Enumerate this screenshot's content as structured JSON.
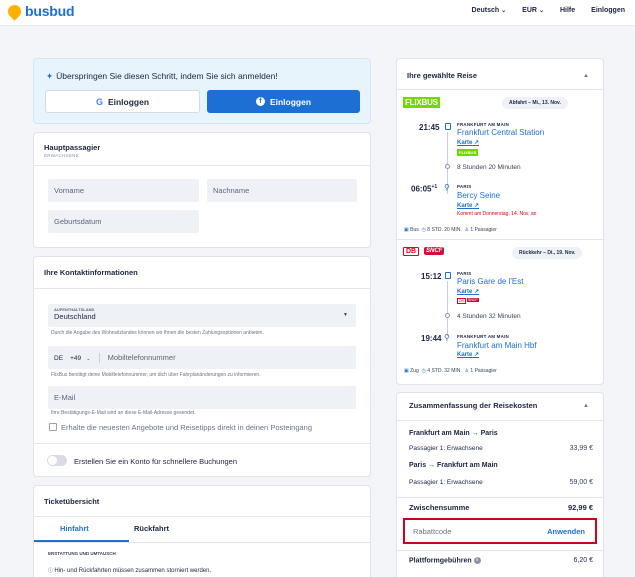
{
  "brand": {
    "name": "busbud"
  },
  "nav": {
    "language": "Deutsch",
    "currency": "EUR",
    "help": "Hilfe",
    "login": "Einloggen"
  },
  "login_card": {
    "title": "Überspringen Sie diesen Schritt, indem Sie sich anmelden!",
    "google_label": "Einloggen",
    "facebook_label": "Einloggen"
  },
  "passenger": {
    "title": "Hauptpassagier",
    "subtitle": "ERWACHSENE",
    "first_name_placeholder": "Vorname",
    "last_name_placeholder": "Nachname",
    "birthdate_placeholder": "Geburtsdatum"
  },
  "contact": {
    "title": "Ihre Kontaktinformationen",
    "country_label": "AUFENTHALTSLAND",
    "country_value": "Deutschland",
    "country_helper": "Durch die Angabe des Wohnsitzlandes können wir Ihnen die besten Zahlungsoptionen anbieten.",
    "phone_country": "DE",
    "phone_prefix": "+49",
    "phone_placeholder": "Mobiltelefonnummer",
    "phone_helper": "FlixBus benötigt deine Mobiltelefonnummer, um dich über Fahrplanänderungen zu informieren.",
    "email_placeholder": "E-Mail",
    "email_helper": "Ihre Bestätigungs-E-Mail wird an diese E-Mail-Adresse gesendet.",
    "offers_label": "Erhalte die neuesten Angebote und Reisetipps direkt in deinen Posteingang",
    "account_label": "Erstellen Sie ein Konto für schnellere Buchungen"
  },
  "ticket": {
    "title": "Ticketübersicht",
    "tabs": [
      "Hinfahrt",
      "Rückfahrt"
    ],
    "refund_label": "ERSTATTUNG UND UMTAUSCH",
    "refund_text": "Hin- und Rückfahrten müssen zusammen storniert werden."
  },
  "trip": {
    "title": "Ihre gewählte Reise",
    "outbound": {
      "carrier": "FLIXBUS",
      "badge": "Abfahrt – Mi., 13. Nov.",
      "dep_time": "21:45",
      "dep_city": "FRANKFURT AM MAIN",
      "dep_station": "Frankfurt Central Station",
      "map_link": "Karte",
      "operator_tag": "FLIXBUS",
      "duration": "8 Stunden 20 Minuten",
      "arr_time": "06:05",
      "arr_day_offset": "+1",
      "arr_city": "PARIS",
      "arr_station": "Bercy Seine",
      "arr_map_link": "Karte",
      "arrival_note": "Kommt am Donnerstag, 14. Nov. an",
      "mode": "Bus",
      "seat_info": "8 STD. 20 MIN.",
      "passengers": "1 Passagier"
    },
    "return": {
      "carrier_1": "DB",
      "carrier_2": "SNCF",
      "badge": "Rückkehr – Di., 19. Nov.",
      "dep_time": "15:12",
      "dep_city": "PARIS",
      "dep_station": "Paris Gare de l'Est",
      "map_link": "Karte",
      "duration": "4 Stunden 32 Minuten",
      "arr_time": "19:44",
      "arr_city": "FRANKFURT AM MAIN",
      "arr_station": "Frankfurt am Main Hbf",
      "arr_map_link": "Karte",
      "mode": "Zug",
      "seat_info": "4 STD. 32 MIN.",
      "passengers": "1 Passagier"
    }
  },
  "summary": {
    "title": "Zusammenfassung der Reisekosten",
    "legs": [
      {
        "route": "Frankfurt am Main → Paris",
        "pax": "Passagier 1: Erwachsene",
        "price": "33,99 €"
      },
      {
        "route": "Paris → Frankfurt am Main",
        "pax": "Passagier 1: Erwachsene",
        "price": "59,00 €"
      }
    ],
    "subtotal_label": "Zwischensumme",
    "subtotal_value": "92,99 €",
    "promo_label": "Rabattcode",
    "promo_apply": "Anwenden",
    "fees_label": "Plattformgebühren",
    "fees_value": "6,20 €"
  },
  "colors": {
    "accent": "#1c70d3",
    "flixbus": "#73d700",
    "alert": "#d0021b"
  }
}
